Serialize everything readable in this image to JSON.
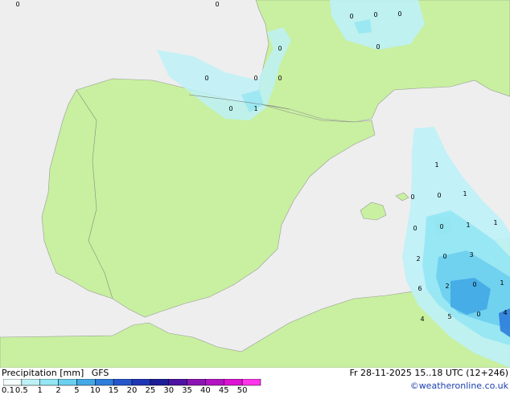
{
  "legend": {
    "title": "Precipitation [mm]",
    "model": "GFS",
    "datetime": "Fr 28-11-2025 15..18 UTC (12+246)",
    "credit": "©weatheronline.co.uk",
    "ticks": [
      "0.1",
      "0.5",
      "1",
      "2",
      "5",
      "10",
      "15",
      "20",
      "25",
      "30",
      "35",
      "40",
      "45",
      "50"
    ],
    "colors": [
      "#f5fdfd",
      "#bdf1f7",
      "#93e6f3",
      "#6bcfee",
      "#43a9e6",
      "#2f7ddc",
      "#2656cc",
      "#1f36b4",
      "#1a1f96",
      "#4d13a3",
      "#8c14b4",
      "#b413c3",
      "#dc12d2",
      "#ff33ea"
    ]
  },
  "map": {
    "sea_color": "#eeeeee",
    "land_color": "#c8f0a0",
    "region": "Iberian Peninsula",
    "values": [
      {
        "text": "0"
      },
      {
        "text": "0"
      },
      {
        "text": "0"
      },
      {
        "text": "0"
      },
      {
        "text": "0"
      },
      {
        "text": "0"
      },
      {
        "text": "0"
      },
      {
        "text": "0"
      },
      {
        "text": "0"
      },
      {
        "text": "0"
      },
      {
        "text": "1"
      },
      {
        "text": "0"
      },
      {
        "text": "1"
      },
      {
        "text": "0"
      },
      {
        "text": "0"
      },
      {
        "text": "1"
      },
      {
        "text": "1"
      },
      {
        "text": "0"
      },
      {
        "text": "0"
      },
      {
        "text": "1"
      },
      {
        "text": "2"
      },
      {
        "text": "0"
      },
      {
        "text": "3"
      },
      {
        "text": "6"
      },
      {
        "text": "2"
      },
      {
        "text": "0"
      },
      {
        "text": "1"
      },
      {
        "text": "4"
      },
      {
        "text": "5"
      },
      {
        "text": "0"
      },
      {
        "text": "4"
      }
    ]
  }
}
